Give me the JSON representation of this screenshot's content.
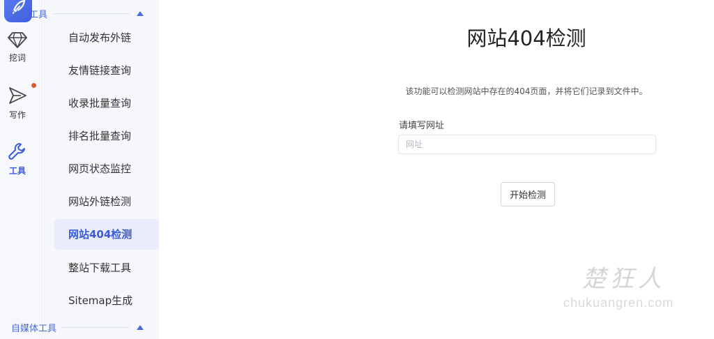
{
  "rail": {
    "items": [
      {
        "label": "挖词",
        "icon": "diamond-icon"
      },
      {
        "label": "写作",
        "icon": "send-icon"
      },
      {
        "label": "工具",
        "icon": "wrench-icon"
      }
    ],
    "notification_color": "#e4572e",
    "accent": "#3b5bd9"
  },
  "submenu": {
    "group_top": "站长工具",
    "items": [
      "自动发布外链",
      "友情链接查询",
      "收录批量查询",
      "排名批量查询",
      "网页状态监控",
      "网站外链检测",
      "网站404检测",
      "整站下载工具",
      "Sitemap生成"
    ],
    "active": "网站404检测",
    "group_bottom": "自媒体工具"
  },
  "main": {
    "title": "网站404检测",
    "description": "该功能可以检测网站中存在的404页面，并将它们记录到文件中。",
    "url_label": "请填写网址",
    "url_placeholder": "网址",
    "url_value": "",
    "start_button": "开始检测"
  },
  "watermark": {
    "cn": "楚狂人",
    "en": "chukuangren.com"
  }
}
